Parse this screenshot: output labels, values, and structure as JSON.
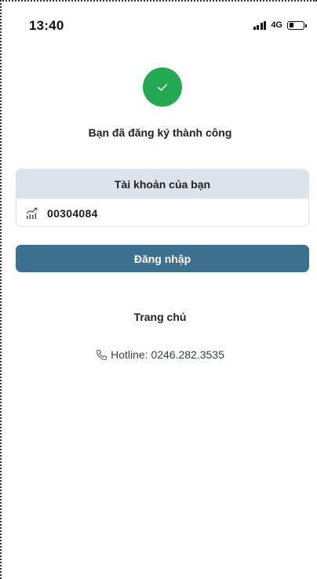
{
  "status_bar": {
    "time": "13:40",
    "network": "4G",
    "battery_level": 0.35
  },
  "success": {
    "message": "Bạn đã đăng ký thành công",
    "color": "#22a952"
  },
  "account": {
    "header": "Tài khoản của bạn",
    "number": "00304084",
    "icon": "stock-chart-icon"
  },
  "login": {
    "label": "Đăng nhập",
    "color": "#3d6f8e"
  },
  "home": {
    "label": "Trang chủ"
  },
  "hotline": {
    "text": "Hotline: 0246.282.3535",
    "icon": "phone-icon"
  }
}
